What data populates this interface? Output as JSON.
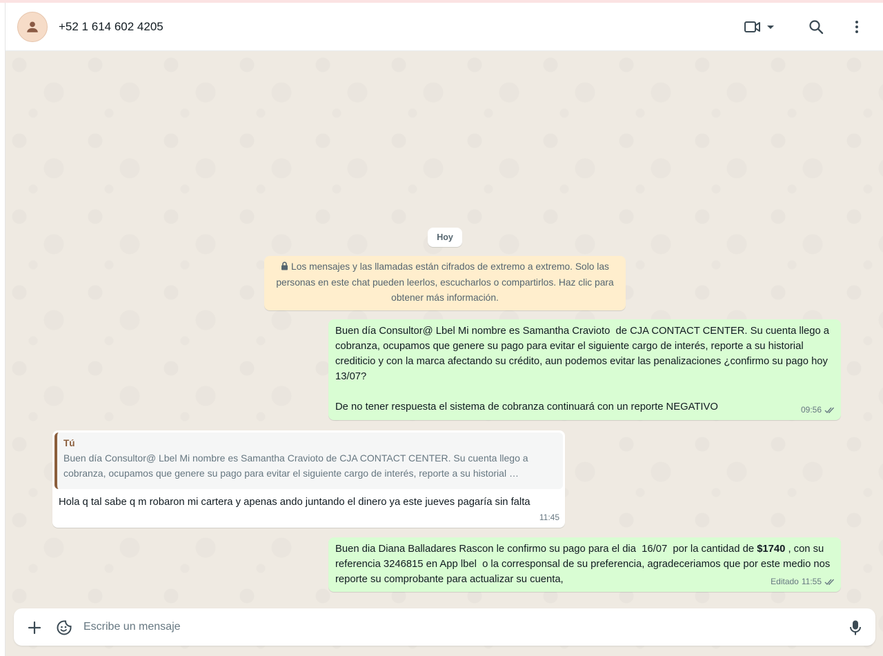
{
  "header": {
    "contact_name": "+52 1 614 602 4205"
  },
  "icons": {
    "avatar": "person-icon",
    "video": "video-camera-icon",
    "dropdown": "caret-down-icon",
    "search": "search-icon",
    "menu": "kebab-menu-icon",
    "lock": "lock-icon",
    "read": "double-check-icon",
    "attach": "plus-icon",
    "sticker": "sticker-icon",
    "mic": "microphone-icon"
  },
  "colors": {
    "outgoing_bubble": "#d9fdd3",
    "incoming_bubble": "#ffffff",
    "wallpaper": "#efeae2",
    "encryption_notice": "#ffeecd",
    "read_check": "#667781"
  },
  "chat": {
    "date_label": "Hoy",
    "encryption_notice": "Los mensajes y las llamadas están cifrados de extremo a extremo. Solo las personas en este chat pueden leerlos, escucharlos o compartirlos. Haz clic para obtener más información.",
    "messages": [
      {
        "direction": "outgoing",
        "text": "Buen día Consultor@ Lbel Mi nombre es Samantha Cravioto  de CJA CONTACT CENTER. Su cuenta llego a cobranza, ocupamos que genere su pago para evitar el siguiente cargo de interés, reporte a su historial crediticio y con la marca afectando su crédito, aun podemos evitar las penalizaciones ¿confirmo su pago hoy 13/07?\n\nDe no tener respuesta el sistema de cobranza continuará con un reporte NEGATIVO",
        "time": "09:56"
      },
      {
        "direction": "incoming",
        "quote_author": "Tú",
        "quote_line1": "Buen día Consultor@ Lbel Mi nombre es Samantha Cravioto  de CJA CONTACT CENTER. Su cuenta llego a",
        "quote_line2": "cobranza, ocupamos que genere su pago para evitar el siguiente cargo de interés, reporte a su historial …",
        "text": "Hola q tal sabe q m robaron mi cartera y apenas ando juntando el dinero ya este jueves pagaría sin falta",
        "time": "11:45"
      },
      {
        "direction": "outgoing",
        "text_before": "Buen dia Diana Balladares Rascon le confirmo su pago para el dia  16/07  por la cantidad de ",
        "text_bold": "$1740",
        "text_after": " , con su referencia 3246815 en App lbel  o la corresponsal de su preferencia, agradeceriamos que por este medio nos reporte su comprobante para actualizar su cuenta,",
        "edited_label": "Editado",
        "time": "11:55"
      }
    ]
  },
  "composer": {
    "placeholder": "Escribe un mensaje",
    "value": ""
  }
}
